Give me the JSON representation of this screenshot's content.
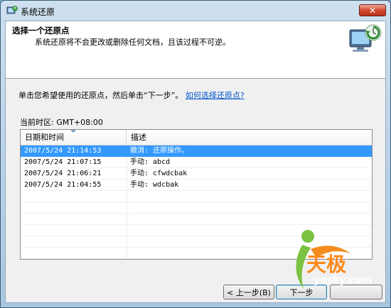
{
  "window": {
    "title": "系统还原",
    "close_label": "✕"
  },
  "header": {
    "title": "选择一个还原点",
    "subtitle": "系统还原将不会更改或删除任何文档，且该过程不可逆。"
  },
  "instruction": {
    "text": "单击您希望使用的还原点，然后单击“下一步”。",
    "link": "如何选择还原点?"
  },
  "timezone": "当前时区: GMT+08:00",
  "list": {
    "columns": [
      "日期和时间",
      "描述"
    ],
    "rows": [
      {
        "datetime": "2007/5/24 21:14:53",
        "description": "撤消: 还原操作。",
        "selected": true
      },
      {
        "datetime": "2007/5/24 21:07:15",
        "description": "手动: abcd",
        "selected": false
      },
      {
        "datetime": "2007/5/24 21:06:21",
        "description": "手动: cfwdcbak",
        "selected": false
      },
      {
        "datetime": "2007/5/24 21:04:55",
        "description": "手动: wdcbak",
        "selected": false
      }
    ]
  },
  "buttons": {
    "back": "< 上一步(B)",
    "next": "下一步"
  },
  "watermark": {
    "cn": "天极",
    "en": "yesky.com"
  },
  "colors": {
    "selection": "#3399ff",
    "link": "#0055cc",
    "close": "#d44a2f"
  }
}
